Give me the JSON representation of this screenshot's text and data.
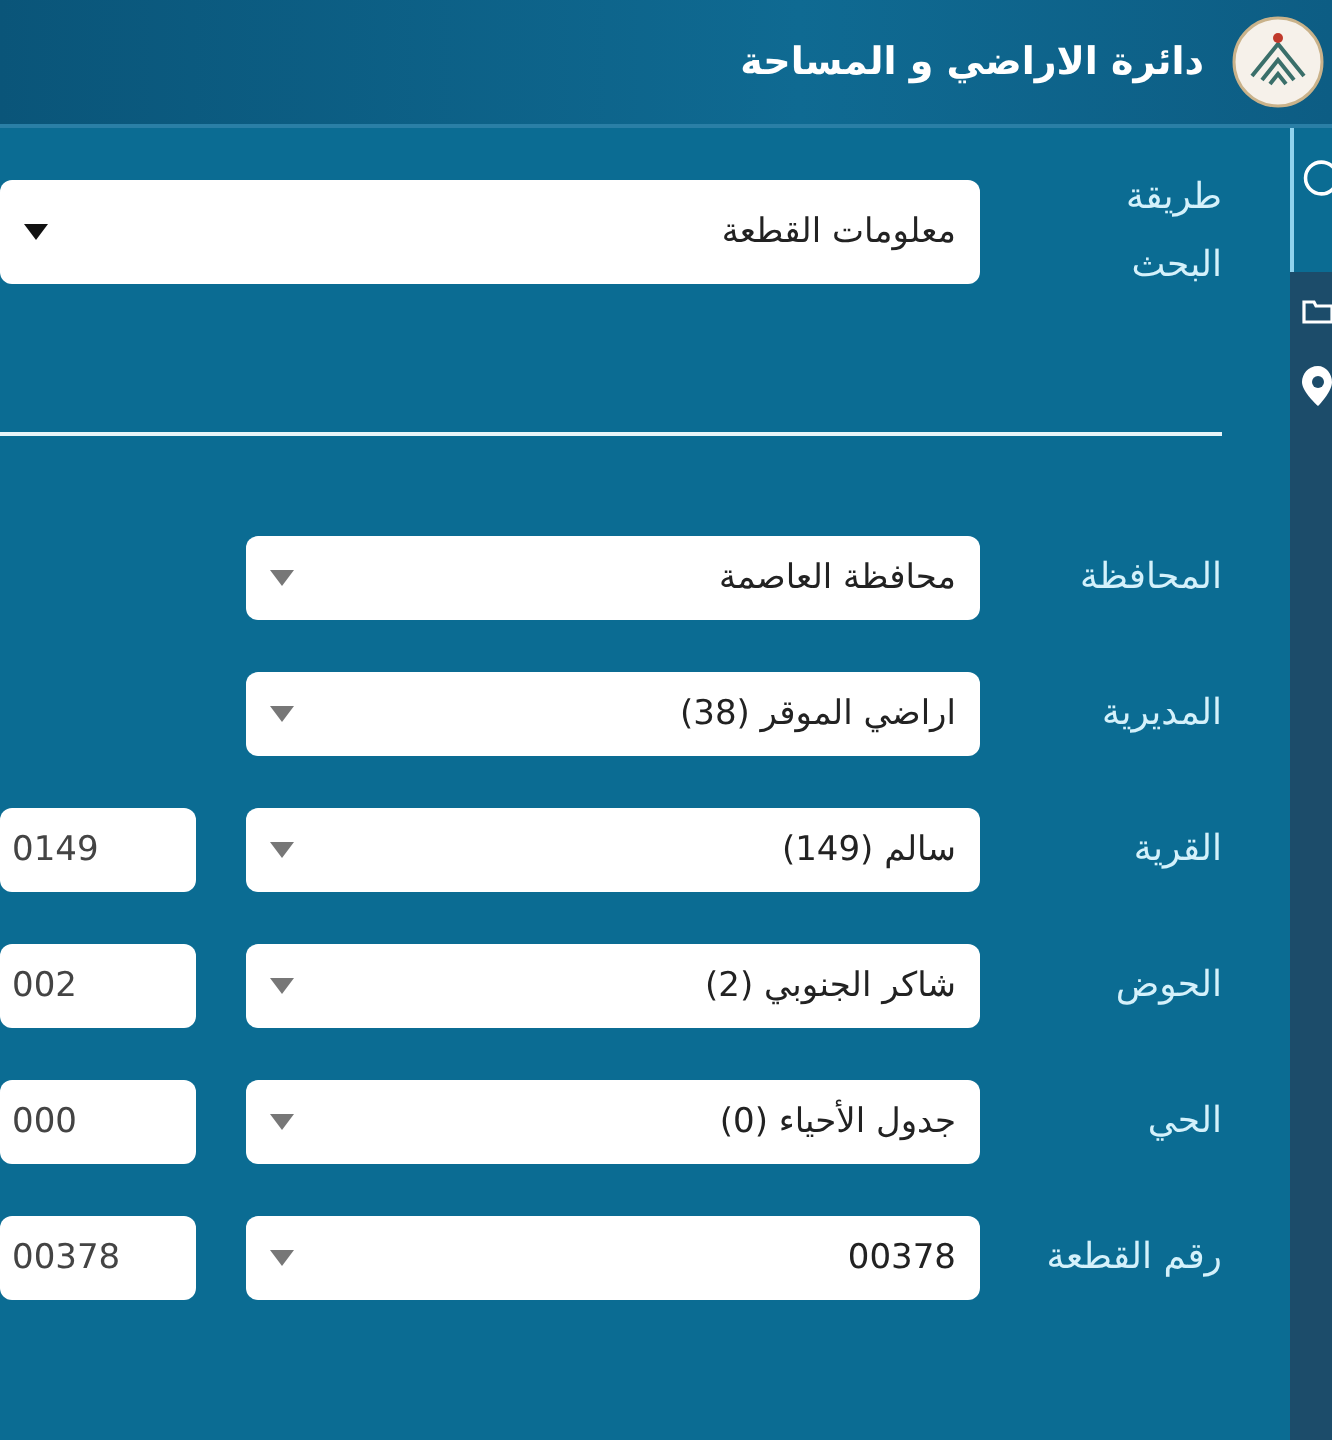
{
  "header": {
    "title": "دائرة الاراضي و المساحة"
  },
  "search_method": {
    "label": "طريقة البحث",
    "value": "معلومات القطعة"
  },
  "fields": [
    {
      "label": "المحافظة",
      "value": "محافظة العاصمة"
    },
    {
      "label": "المديرية",
      "value": "اراضي الموقر (38)"
    },
    {
      "label": "القرية",
      "value": "سالم (149)",
      "code": "0149"
    },
    {
      "label": "الحوض",
      "value": "شاكر الجنوبي (2)",
      "code": "002"
    },
    {
      "label": "الحي",
      "value": "جدول الأحياء (0)",
      "code": "000"
    },
    {
      "label": "رقم القطعة",
      "value": "00378",
      "code": "00378"
    }
  ]
}
